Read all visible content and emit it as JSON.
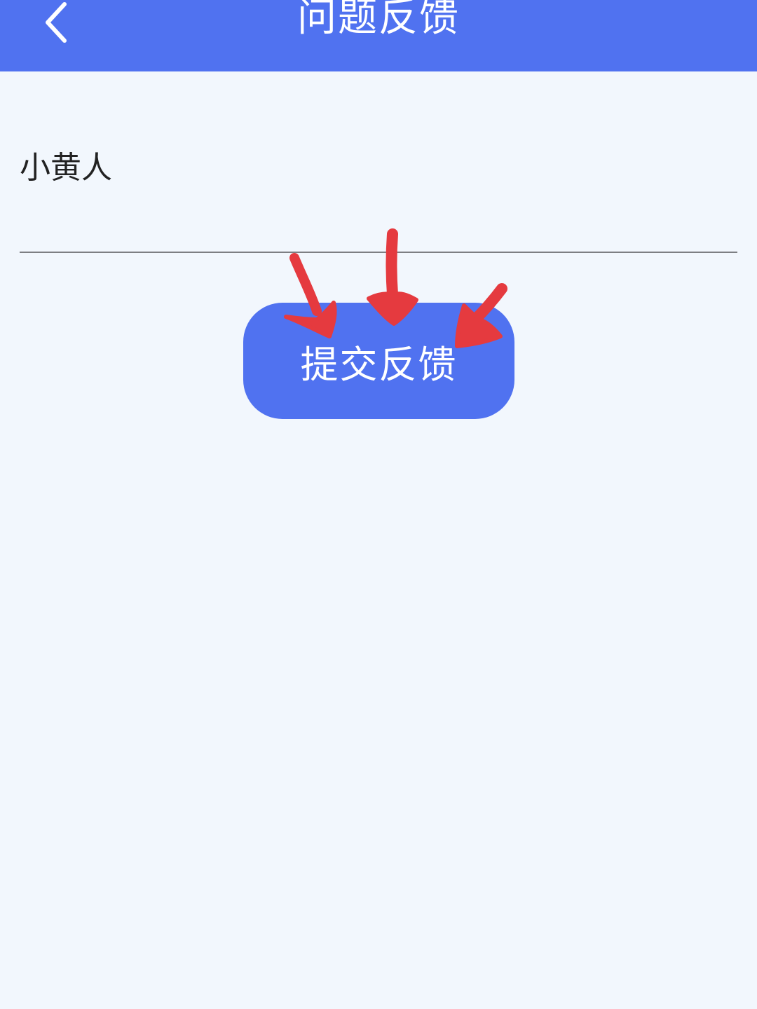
{
  "header": {
    "title": "问题反馈",
    "back_icon": "chevron-left-icon",
    "background_color": "#5072f0"
  },
  "form": {
    "input_value": "小黄人",
    "submit_label": "提交反馈",
    "button_color": "#5072f0"
  },
  "annotations": {
    "arrow_color": "#e53a3f",
    "arrow_count": 3
  }
}
